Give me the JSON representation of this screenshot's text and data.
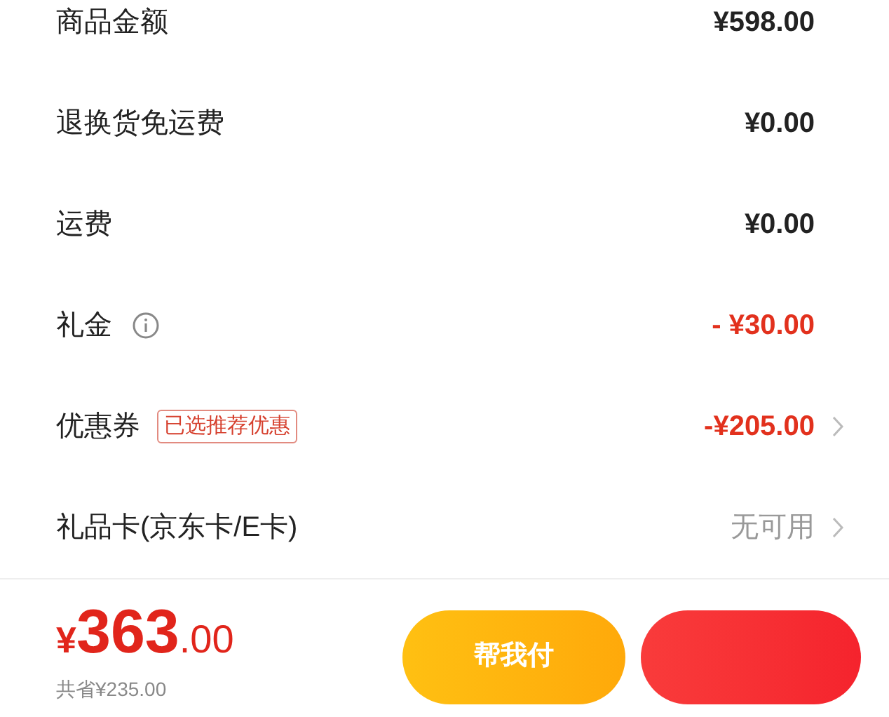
{
  "rows": [
    {
      "label": "商品金额",
      "kind": "amount",
      "value": "¥598.00",
      "info": false,
      "chevron": false
    },
    {
      "label": "退换货免运费",
      "kind": "amount",
      "value": "¥0.00",
      "info": false,
      "chevron": false
    },
    {
      "label": "运费",
      "kind": "amount",
      "value": "¥0.00",
      "info": false,
      "chevron": false
    },
    {
      "label": "礼金",
      "kind": "discount",
      "value": "- ¥30.00",
      "info": true,
      "chevron": false
    },
    {
      "label": "优惠券",
      "kind": "discount",
      "value": "-¥205.00",
      "tag": "已选推荐优惠",
      "info": false,
      "chevron": true
    },
    {
      "label": "礼品卡(京东卡/E卡)",
      "kind": "muted",
      "value": "无可用",
      "info": false,
      "chevron": true
    }
  ],
  "footer": {
    "currency": "¥",
    "total_integer": "363",
    "total_decimal": ".00",
    "savings": "共省¥235.00",
    "buttons": [
      {
        "kind": "secondary",
        "label": "帮我付"
      },
      {
        "kind": "primary"
      }
    ]
  }
}
